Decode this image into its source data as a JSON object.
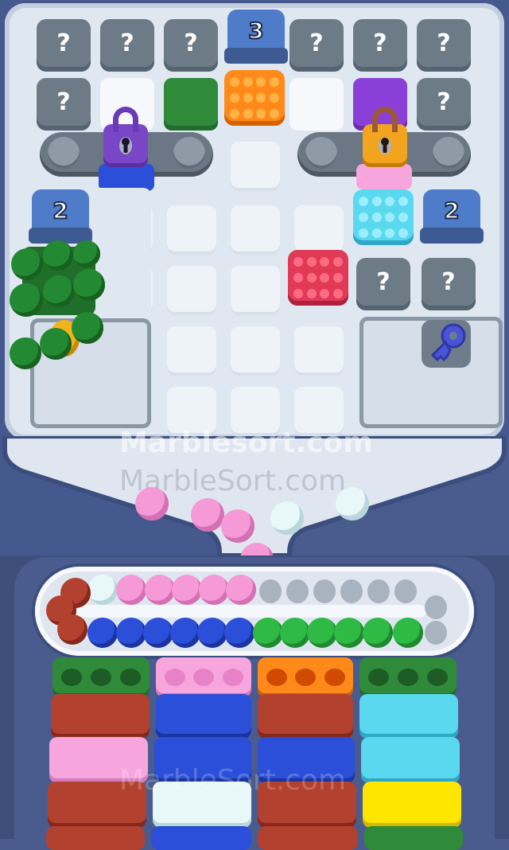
{
  "game": {
    "watermark_primary": "Marblesort.com",
    "watermark_secondary": "MarbleSort.com",
    "watermark_tray": "MarbleSort.com",
    "counters": {
      "top": "3",
      "left": "2",
      "right": "2"
    },
    "mystery_label": "?",
    "colors": {
      "board": "#dfe7f1",
      "frame": "#46598f",
      "mystery": "#6d7b87",
      "orange": "#ff8a1a",
      "cyan": "#5ad8f0",
      "crimson": "#e03a57",
      "green": "#2fa843",
      "purple": "#8a3fd8",
      "blue": "#2b4fd8",
      "pink": "#f59ad6",
      "brown": "#b3412f",
      "yellow": "#ffe600",
      "lock_purple": "#7a46c8",
      "lock_gold": "#f2a41f",
      "key": "#4a55d6"
    },
    "track": {
      "top_row": [
        "white",
        "pink",
        "pink",
        "pink",
        "pink",
        "pink"
      ],
      "bottom_row": [
        "blue",
        "blue",
        "blue",
        "blue",
        "blue",
        "blue",
        "green",
        "green",
        "green",
        "green",
        "green",
        "green"
      ],
      "curve": [
        "brown",
        "brown",
        "brown",
        "brown"
      ]
    },
    "falling_marbles": [
      "pink",
      "pink",
      "pink",
      "pink",
      "white",
      "white"
    ],
    "tray_columns": [
      {
        "top": "green",
        "stack": [
          "brown",
          "pink",
          "brown",
          "brown"
        ]
      },
      {
        "top": "pink",
        "stack": [
          "blue",
          "blue",
          "white",
          "blue"
        ]
      },
      {
        "top": "orange",
        "stack": [
          "brown",
          "blue",
          "brown",
          "brown"
        ]
      },
      {
        "top": "green",
        "stack": [
          "cyan",
          "cyan",
          "yellow",
          "green"
        ]
      }
    ],
    "icons": [
      "lock-icon",
      "key-icon",
      "question-icon"
    ]
  }
}
